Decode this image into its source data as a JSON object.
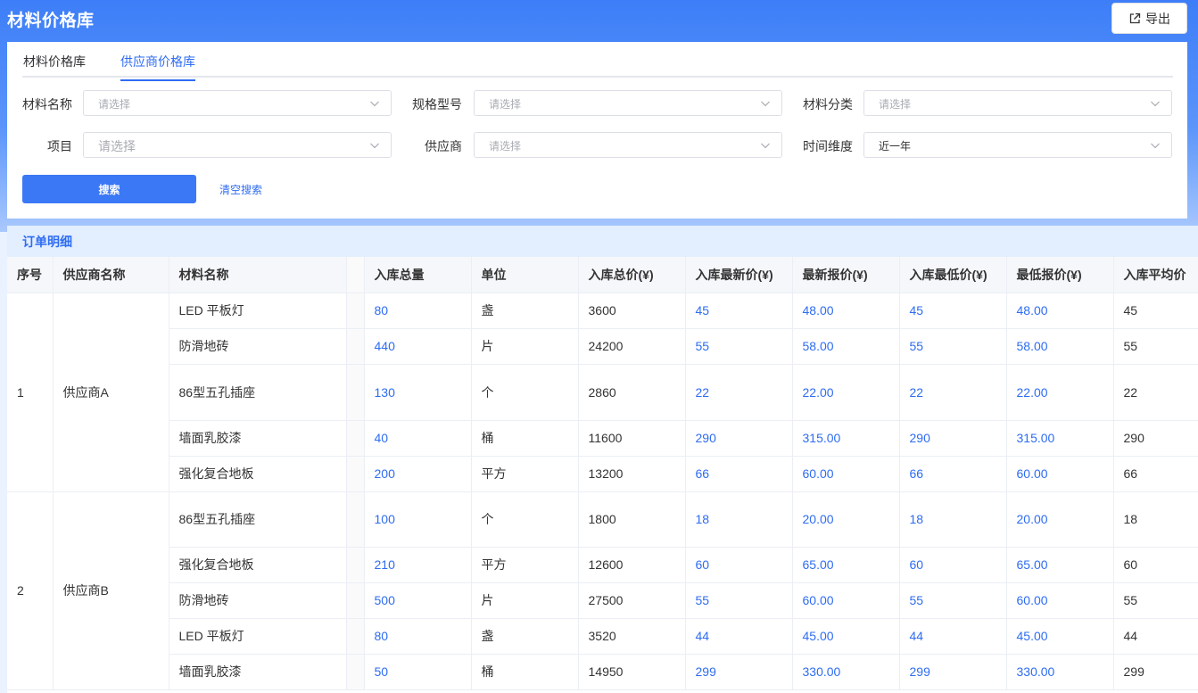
{
  "app": {
    "title": "材料价格库",
    "export_label": "导出"
  },
  "tabs": [
    {
      "label": "材料价格库"
    },
    {
      "label": "供应商价格库"
    }
  ],
  "filters": {
    "material_name": {
      "label": "材料名称",
      "placeholder": "请选择"
    },
    "spec_model": {
      "label": "规格型号",
      "placeholder": "请选择"
    },
    "category": {
      "label": "材料分类",
      "placeholder": "请选择"
    },
    "project": {
      "label": "项目",
      "placeholder": "请选择"
    },
    "supplier": {
      "label": "供应商",
      "placeholder": "请选择"
    },
    "time_dimension": {
      "label": "时间维度",
      "value": "近一年"
    },
    "search_label": "搜索",
    "clear_label": "清空搜索"
  },
  "orders": {
    "title": "订单明细",
    "columns": [
      "序号",
      "供应商名称",
      "材料名称",
      "入库总量",
      "单位",
      "入库总价(¥)",
      "入库最新价(¥)",
      "最新报价(¥)",
      "入库最低价(¥)",
      "最低报价(¥)",
      "入库平均价"
    ],
    "groups": [
      {
        "index": "1",
        "supplier": "供应商A",
        "rows": [
          {
            "material": "LED 平板灯",
            "qty": "80",
            "unit": "盏",
            "total": "3600",
            "latest_in": "45",
            "latest_quote": "48.00",
            "min_in": "45",
            "min_quote": "48.00",
            "avg_in": "45"
          },
          {
            "material": "防滑地砖",
            "qty": "440",
            "unit": "片",
            "total": "24200",
            "latest_in": "55",
            "latest_quote": "58.00",
            "min_in": "55",
            "min_quote": "58.00",
            "avg_in": "55"
          },
          {
            "material": "86型五孔插座",
            "qty": "130",
            "unit": "个",
            "total": "2860",
            "latest_in": "22",
            "latest_quote": "22.00",
            "min_in": "22",
            "min_quote": "22.00",
            "avg_in": "22"
          },
          {
            "material": "墙面乳胶漆",
            "qty": "40",
            "unit": "桶",
            "total": "11600",
            "latest_in": "290",
            "latest_quote": "315.00",
            "min_in": "290",
            "min_quote": "315.00",
            "avg_in": "290"
          },
          {
            "material": "强化复合地板",
            "qty": "200",
            "unit": "平方",
            "total": "13200",
            "latest_in": "66",
            "latest_quote": "60.00",
            "min_in": "66",
            "min_quote": "60.00",
            "avg_in": "66"
          }
        ]
      },
      {
        "index": "2",
        "supplier": "供应商B",
        "rows": [
          {
            "material": "86型五孔插座",
            "qty": "100",
            "unit": "个",
            "total": "1800",
            "latest_in": "18",
            "latest_quote": "20.00",
            "min_in": "18",
            "min_quote": "20.00",
            "avg_in": "18"
          },
          {
            "material": "强化复合地板",
            "qty": "210",
            "unit": "平方",
            "total": "12600",
            "latest_in": "60",
            "latest_quote": "65.00",
            "min_in": "60",
            "min_quote": "65.00",
            "avg_in": "60"
          },
          {
            "material": "防滑地砖",
            "qty": "500",
            "unit": "片",
            "total": "27500",
            "latest_in": "55",
            "latest_quote": "60.00",
            "min_in": "55",
            "min_quote": "60.00",
            "avg_in": "55"
          },
          {
            "material": "LED 平板灯",
            "qty": "80",
            "unit": "盏",
            "total": "3520",
            "latest_in": "44",
            "latest_quote": "45.00",
            "min_in": "44",
            "min_quote": "45.00",
            "avg_in": "44"
          },
          {
            "material": "墙面乳胶漆",
            "qty": "50",
            "unit": "桶",
            "total": "14950",
            "latest_in": "299",
            "latest_quote": "330.00",
            "min_in": "299",
            "min_quote": "330.00",
            "avg_in": "299"
          }
        ]
      }
    ]
  },
  "colors": {
    "primary": "#2e6cf2",
    "header_blue": "#3d7ef8",
    "section_bg": "#e3eefe"
  }
}
